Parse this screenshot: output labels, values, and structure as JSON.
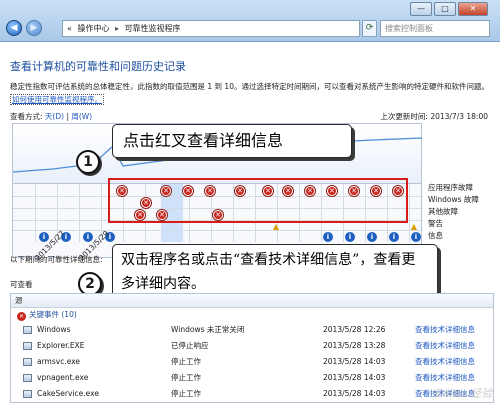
{
  "window": {
    "breadcrumb": [
      "操作中心",
      "可靠性监视程序"
    ],
    "search_placeholder": "搜索控制面板",
    "controls": [
      "—",
      "□",
      "✕"
    ]
  },
  "page": {
    "heading": "查看计算机的可靠性和问题历史记录",
    "description": "稳定性指数可评估系统的总体稳定性，此指数的取值范围是 1 到 10。通过选择特定时间期间，可以查看对系统产生影响的特定硬件和软件问题。",
    "description_link": "如何使用可靠性监视程序。",
    "view_by_label": "查看方式:",
    "view_by_days": "天(D)",
    "view_by_sep": "|",
    "view_by_weeks": "周(W)",
    "last_updated_label": "上次更新时间:",
    "last_updated_value": "2013/7/3 18:00"
  },
  "chart": {
    "row_labels": [
      "应用程序故障",
      "Windows 故障",
      "其他故障",
      "警告",
      "信息"
    ],
    "date_labels": [
      "2013/5/27",
      "2013/5/29"
    ]
  },
  "annotations": {
    "badge1": "1",
    "callout1": "点击红叉查看详细信息",
    "badge2": "2",
    "callout2": "双击程序名或点击“查看技术详细信息”，查看更多详细内容。"
  },
  "list": {
    "below_label": "以下期间的可靠性详细信息:",
    "check_label": "可查看",
    "header": "源",
    "section_title": "关键事件 (10)",
    "rows": [
      {
        "name": "Windows",
        "summary": "Windows 未正常关闭",
        "date": "2013/5/28 12:26",
        "action": "查看技术详细信息"
      },
      {
        "name": "Explorer.EXE",
        "summary": "已停止响应",
        "date": "2013/5/28 13:28",
        "action": "查看技术详细信息"
      },
      {
        "name": "armsvc.exe",
        "summary": "停止工作",
        "date": "2013/5/28 14:03",
        "action": "查看技术详细信息"
      },
      {
        "name": "vpnagent.exe",
        "summary": "停止工作",
        "date": "2013/5/28 14:03",
        "action": "查看技术详细信息"
      },
      {
        "name": "CakeService.exe",
        "summary": "停止工作",
        "date": "2013/5/28 14:03",
        "action": "查看技术详细信息"
      }
    ]
  },
  "watermark": "Baidu 经验"
}
